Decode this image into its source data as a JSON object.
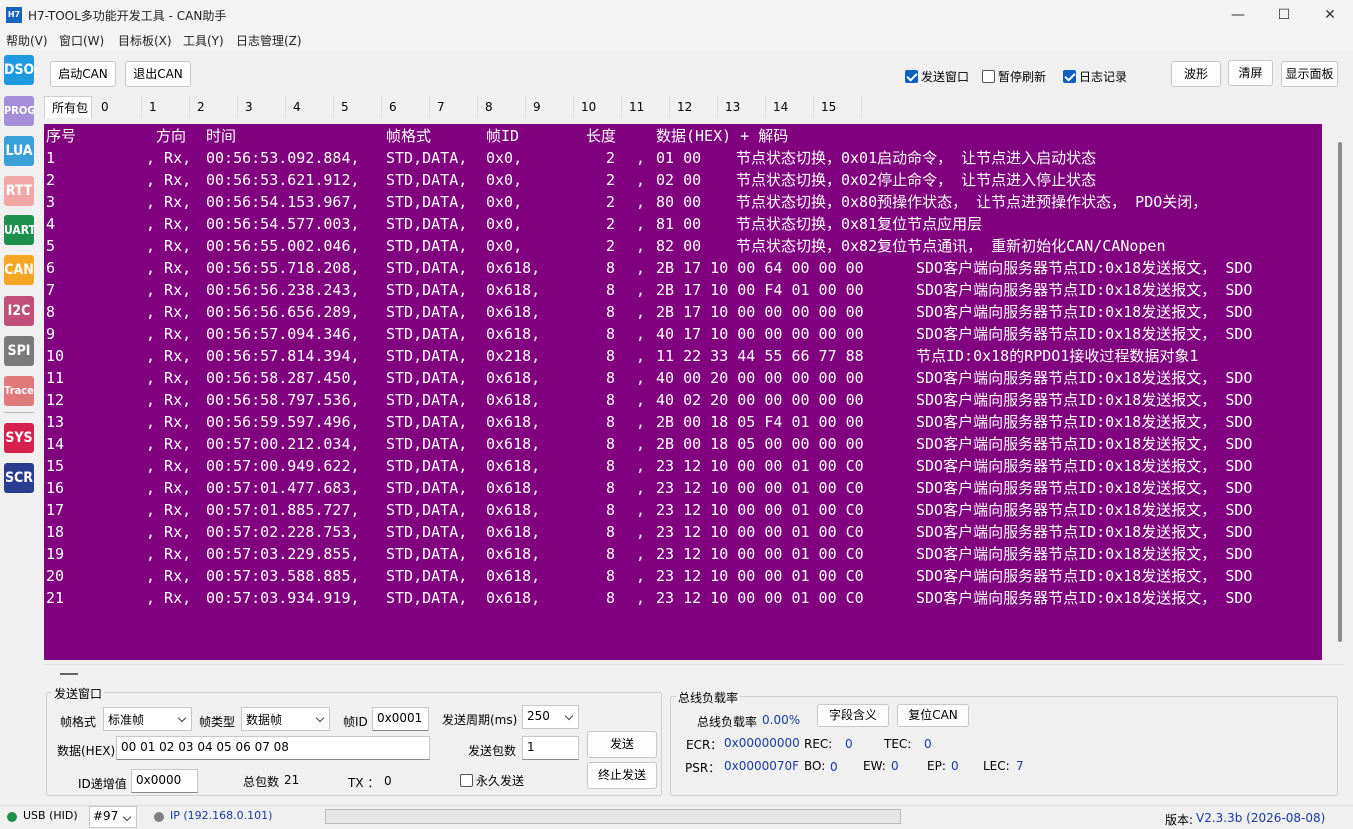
{
  "window": {
    "icon_text": "H7",
    "title": "H7-TOOL多功能开发工具 - CAN助手",
    "minimize": "—",
    "maximize": "☐",
    "close": "✕"
  },
  "menu": [
    "帮助(V)",
    "窗口(W)",
    "目标板(X)",
    "工具(Y)",
    "日志管理(Z)"
  ],
  "sidebar": [
    {
      "label": "DSO",
      "color": "#1e9be0"
    },
    {
      "label": "PROG",
      "color": "#a58fd8"
    },
    {
      "label": "LUA",
      "color": "#3aa0d8"
    },
    {
      "label": "RTT",
      "color": "#f2a7a7"
    },
    {
      "label": "UART",
      "color": "#1f8f4e"
    },
    {
      "label": "CAN",
      "color": "#f5a623"
    },
    {
      "label": "I2C",
      "color": "#c0507a"
    },
    {
      "label": "SPI",
      "color": "#7a7a7a"
    },
    {
      "label": "Trace",
      "color": "#e07a7a"
    },
    {
      "label": "SYS",
      "color": "#d6204e"
    },
    {
      "label": "SCR",
      "color": "#2a3d8f"
    }
  ],
  "toolbar": {
    "start_can": "启动CAN",
    "exit_can": "退出CAN",
    "send_window": "发送窗口",
    "pause_refresh": "暂停刷新",
    "log_record": "日志记录",
    "waveform": "波形",
    "clear": "清屏",
    "show_panel": "显示面板"
  },
  "toolbar_state": {
    "send_window": true,
    "pause_refresh": false,
    "log_record": true
  },
  "tabs": [
    "所有包",
    "0",
    "1",
    "2",
    "3",
    "4",
    "5",
    "6",
    "7",
    "8",
    "9",
    "10",
    "11",
    "12",
    "13",
    "14",
    "15"
  ],
  "log": {
    "header": {
      "seq": "序号",
      "dir": "方向",
      "time": "时间",
      "fmt": "帧格式",
      "id": "帧ID",
      "len": "长度",
      "data": "数据(HEX) + 解码"
    },
    "rows": [
      {
        "seq": "1",
        "dir": ", Rx,",
        "time": "00:56:53.092.884,",
        "fmt": "STD,DATA,",
        "id": "0x0,",
        "len": "2",
        "hex": "01 00",
        "decode": "节点状态切换，0x01启动命令， 让节点进入启动状态"
      },
      {
        "seq": "2",
        "dir": ", Rx,",
        "time": "00:56:53.621.912,",
        "fmt": "STD,DATA,",
        "id": "0x0,",
        "len": "2",
        "hex": "02 00",
        "decode": "节点状态切换，0x02停止命令， 让节点进入停止状态"
      },
      {
        "seq": "3",
        "dir": ", Rx,",
        "time": "00:56:54.153.967,",
        "fmt": "STD,DATA,",
        "id": "0x0,",
        "len": "2",
        "hex": "80 00",
        "decode": "节点状态切换，0x80预操作状态， 让节点进预操作状态， PDO关闭，"
      },
      {
        "seq": "4",
        "dir": ", Rx,",
        "time": "00:56:54.577.003,",
        "fmt": "STD,DATA,",
        "id": "0x0,",
        "len": "2",
        "hex": "81 00",
        "decode": "节点状态切换，0x81复位节点应用层"
      },
      {
        "seq": "5",
        "dir": ", Rx,",
        "time": "00:56:55.002.046,",
        "fmt": "STD,DATA,",
        "id": "0x0,",
        "len": "2",
        "hex": "82 00",
        "decode": "节点状态切换，0x82复位节点通讯， 重新初始化CAN/CANopen"
      },
      {
        "seq": "6",
        "dir": ", Rx,",
        "time": "00:56:55.718.208,",
        "fmt": "STD,DATA,",
        "id": "0x618,",
        "len": "8",
        "hex": "2B 17 10 00 64 00 00 00",
        "decode": "SDO客户端向服务器节点ID:0x18发送报文， SDO"
      },
      {
        "seq": "7",
        "dir": ", Rx,",
        "time": "00:56:56.238.243,",
        "fmt": "STD,DATA,",
        "id": "0x618,",
        "len": "8",
        "hex": "2B 17 10 00 F4 01 00 00",
        "decode": "SDO客户端向服务器节点ID:0x18发送报文， SDO"
      },
      {
        "seq": "8",
        "dir": ", Rx,",
        "time": "00:56:56.656.289,",
        "fmt": "STD,DATA,",
        "id": "0x618,",
        "len": "8",
        "hex": "2B 17 10 00 00 00 00 00",
        "decode": "SDO客户端向服务器节点ID:0x18发送报文， SDO"
      },
      {
        "seq": "9",
        "dir": ", Rx,",
        "time": "00:56:57.094.346,",
        "fmt": "STD,DATA,",
        "id": "0x618,",
        "len": "8",
        "hex": "40 17 10 00 00 00 00 00",
        "decode": "SDO客户端向服务器节点ID:0x18发送报文， SDO"
      },
      {
        "seq": "10",
        "dir": ", Rx,",
        "time": "00:56:57.814.394,",
        "fmt": "STD,DATA,",
        "id": "0x218,",
        "len": "8",
        "hex": "11 22 33 44 55 66 77 88",
        "decode": "节点ID:0x18的RPDO1接收过程数据对象1"
      },
      {
        "seq": "11",
        "dir": ", Rx,",
        "time": "00:56:58.287.450,",
        "fmt": "STD,DATA,",
        "id": "0x618,",
        "len": "8",
        "hex": "40 00 20 00 00 00 00 00",
        "decode": "SDO客户端向服务器节点ID:0x18发送报文， SDO"
      },
      {
        "seq": "12",
        "dir": ", Rx,",
        "time": "00:56:58.797.536,",
        "fmt": "STD,DATA,",
        "id": "0x618,",
        "len": "8",
        "hex": "40 02 20 00 00 00 00 00",
        "decode": "SDO客户端向服务器节点ID:0x18发送报文， SDO"
      },
      {
        "seq": "13",
        "dir": ", Rx,",
        "time": "00:56:59.597.496,",
        "fmt": "STD,DATA,",
        "id": "0x618,",
        "len": "8",
        "hex": "2B 00 18 05 F4 01 00 00",
        "decode": "SDO客户端向服务器节点ID:0x18发送报文， SDO"
      },
      {
        "seq": "14",
        "dir": ", Rx,",
        "time": "00:57:00.212.034,",
        "fmt": "STD,DATA,",
        "id": "0x618,",
        "len": "8",
        "hex": "2B 00 18 05 00 00 00 00",
        "decode": "SDO客户端向服务器节点ID:0x18发送报文， SDO"
      },
      {
        "seq": "15",
        "dir": ", Rx,",
        "time": "00:57:00.949.622,",
        "fmt": "STD,DATA,",
        "id": "0x618,",
        "len": "8",
        "hex": "23 12 10 00 00 01 00 C0",
        "decode": "SDO客户端向服务器节点ID:0x18发送报文， SDO"
      },
      {
        "seq": "16",
        "dir": ", Rx,",
        "time": "00:57:01.477.683,",
        "fmt": "STD,DATA,",
        "id": "0x618,",
        "len": "8",
        "hex": "23 12 10 00 00 01 00 C0",
        "decode": "SDO客户端向服务器节点ID:0x18发送报文， SDO"
      },
      {
        "seq": "17",
        "dir": ", Rx,",
        "time": "00:57:01.885.727,",
        "fmt": "STD,DATA,",
        "id": "0x618,",
        "len": "8",
        "hex": "23 12 10 00 00 01 00 C0",
        "decode": "SDO客户端向服务器节点ID:0x18发送报文， SDO"
      },
      {
        "seq": "18",
        "dir": ", Rx,",
        "time": "00:57:02.228.753,",
        "fmt": "STD,DATA,",
        "id": "0x618,",
        "len": "8",
        "hex": "23 12 10 00 00 01 00 C0",
        "decode": "SDO客户端向服务器节点ID:0x18发送报文， SDO"
      },
      {
        "seq": "19",
        "dir": ", Rx,",
        "time": "00:57:03.229.855,",
        "fmt": "STD,DATA,",
        "id": "0x618,",
        "len": "8",
        "hex": "23 12 10 00 00 01 00 C0",
        "decode": "SDO客户端向服务器节点ID:0x18发送报文， SDO"
      },
      {
        "seq": "20",
        "dir": ", Rx,",
        "time": "00:57:03.588.885,",
        "fmt": "STD,DATA,",
        "id": "0x618,",
        "len": "8",
        "hex": "23 12 10 00 00 01 00 C0",
        "decode": "SDO客户端向服务器节点ID:0x18发送报文， SDO"
      },
      {
        "seq": "21",
        "dir": ", Rx,",
        "time": "00:57:03.934.919,",
        "fmt": "STD,DATA,",
        "id": "0x618,",
        "len": "8",
        "hex": "23 12 10 00 00 01 00 C0",
        "decode": "SDO客户端向服务器节点ID:0x18发送报文， SDO"
      }
    ],
    "background": "#800080"
  },
  "send": {
    "group_title": "发送窗口",
    "frame_fmt_label": "帧格式",
    "frame_fmt_value": "标准帧",
    "frame_type_label": "帧类型",
    "frame_type_value": "数据帧",
    "frame_id_label": "帧ID",
    "frame_id_value": "0x0001",
    "period_label": "发送周期(ms)",
    "period_value": "250",
    "data_label": "数据(HEX)",
    "data_value": "00 01 02 03 04 05 06 07 08",
    "count_label": "发送包数",
    "count_value": "1",
    "send_btn": "发送",
    "id_inc_label": "ID递增值",
    "id_inc_value": "0x0000",
    "total_label": "总包数",
    "total_value": "21",
    "tx_label": "TX ：",
    "tx_value": "0",
    "forever_label": "永久发送",
    "stop_btn": "终止发送"
  },
  "bus": {
    "group_title": "总线负载率",
    "load_label": "总线负载率",
    "load_value": "0.00%",
    "field_btn": "字段含义",
    "reset_btn": "复位CAN",
    "ecr_label": "ECR：",
    "ecr_value": "0x00000000",
    "rec_label": "REC:",
    "rec_value": "0",
    "tec_label": "TEC:",
    "tec_value": "0",
    "psr_label": "PSR：",
    "psr_value": "0x0000070F",
    "bo_label": "BO:",
    "bo_value": "0",
    "ew_label": "EW:",
    "ew_value": "0",
    "ep_label": "EP:",
    "ep_value": "0",
    "lec_label": "LEC:",
    "lec_value": "7"
  },
  "status": {
    "usb": "USB (HID)",
    "usb_color": "#1f8f4e",
    "device": "#97",
    "ip": "IP (192.168.0.101)",
    "ip_color": "#808080",
    "version_label": "版本:",
    "version_value": "V2.3.3b (2026-08-08)"
  }
}
